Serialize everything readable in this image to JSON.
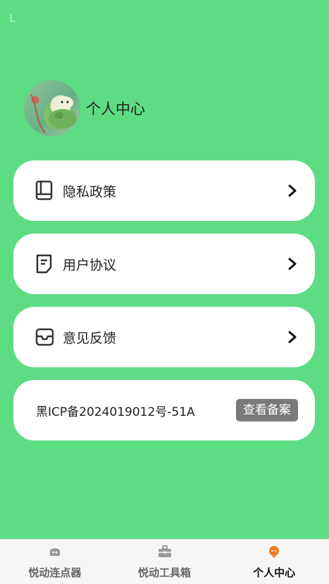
{
  "status": {
    "indicator": "L"
  },
  "profile": {
    "title": "个人中心",
    "avatar_icon": "avatar-image"
  },
  "menu": [
    {
      "label": "隐私政策",
      "icon": "book-icon"
    },
    {
      "label": "用户协议",
      "icon": "document-icon"
    },
    {
      "label": "意见反馈",
      "icon": "inbox-icon"
    }
  ],
  "icp": {
    "text": "黑ICP备2024019012号-51A",
    "button": "查看备案"
  },
  "tabbar": {
    "tabs": [
      {
        "label": "悦动连点器",
        "icon": "robot-icon",
        "active": false
      },
      {
        "label": "悦动工具箱",
        "icon": "toolbox-icon",
        "active": false
      },
      {
        "label": "个人中心",
        "icon": "person-icon",
        "active": true
      }
    ],
    "active_color": "#f07a1f",
    "inactive_color": "#9a9a9a"
  },
  "colors": {
    "background": "#5edc84",
    "card": "#ffffff",
    "icp_button": "#7a7a7a"
  }
}
